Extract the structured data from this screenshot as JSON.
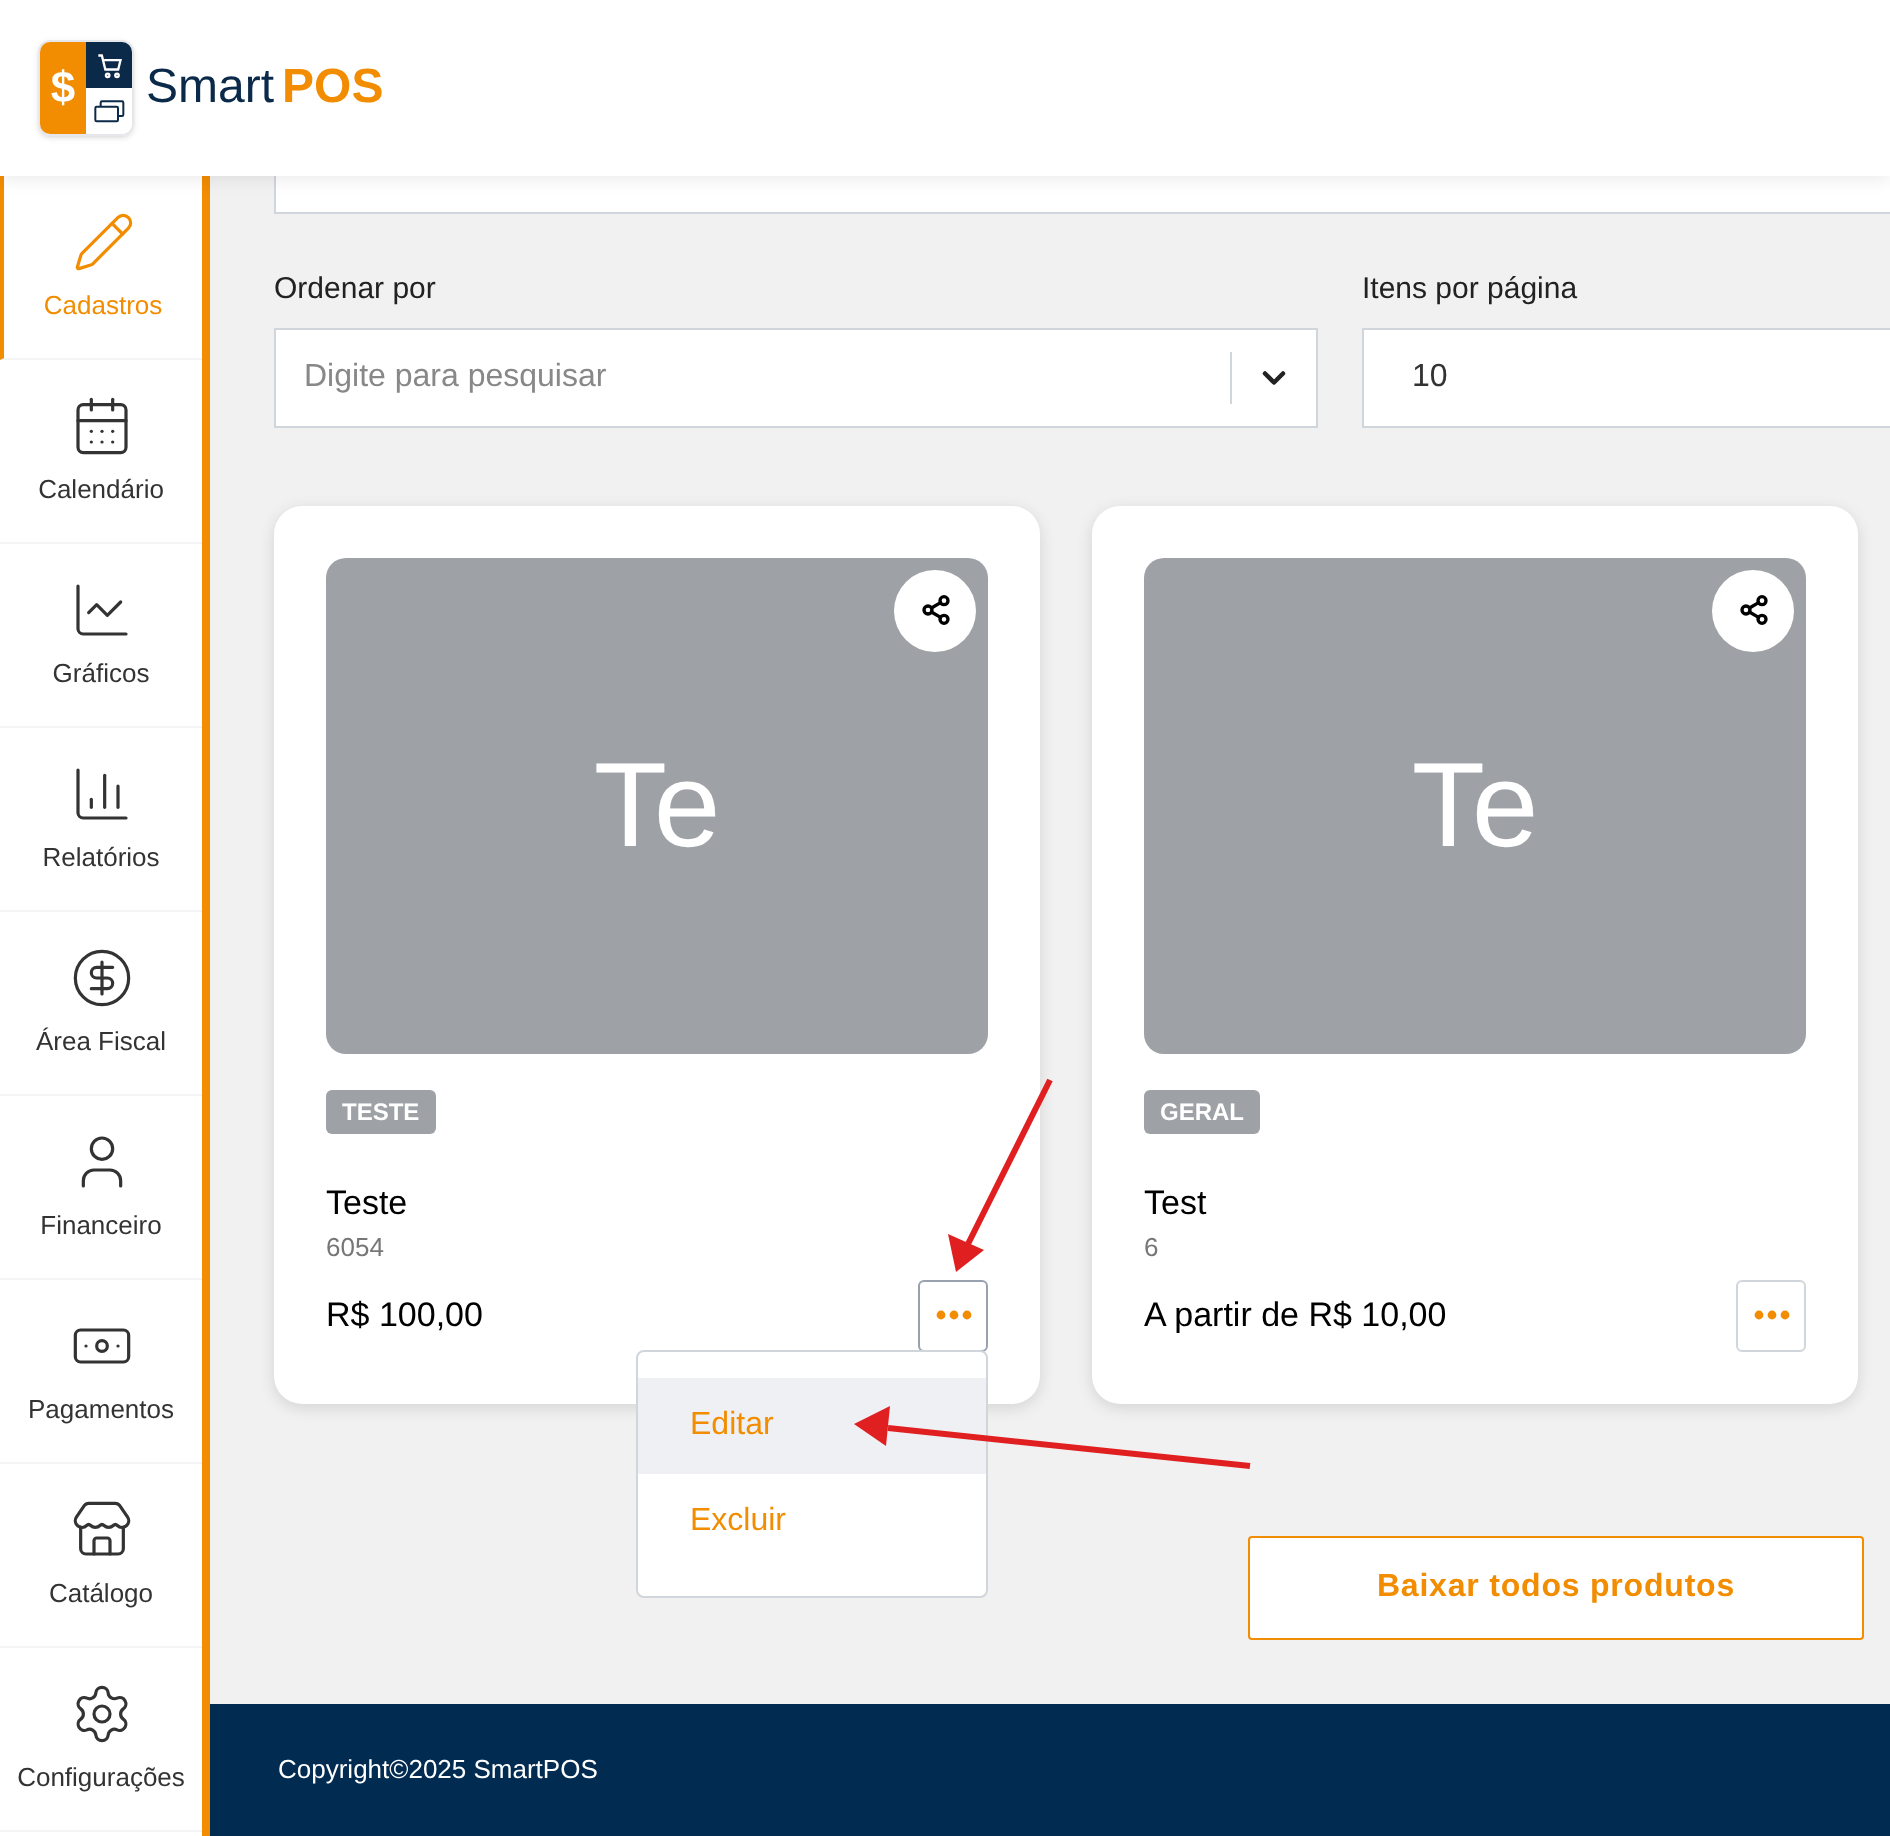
{
  "brand": {
    "mark": "$",
    "name": "Smart",
    "accent": "POS"
  },
  "sidebar": {
    "items": [
      {
        "label": "Cadastros",
        "selected": true
      },
      {
        "label": "Calendário",
        "selected": false
      },
      {
        "label": "Gráficos",
        "selected": false
      },
      {
        "label": "Relatórios",
        "selected": false
      },
      {
        "label": "Área Fiscal",
        "selected": false
      },
      {
        "label": "Financeiro",
        "selected": false
      },
      {
        "label": "Pagamentos",
        "selected": false
      },
      {
        "label": "Catálogo",
        "selected": false
      },
      {
        "label": "Configurações",
        "selected": false
      }
    ]
  },
  "sort": {
    "label": "Ordenar por",
    "placeholder": "Digite para pesquisar"
  },
  "per_page": {
    "label": "Itens por página",
    "value": "10"
  },
  "products": [
    {
      "initials": "Te",
      "tag": "TESTE",
      "name": "Teste",
      "code": "6054",
      "price": "R$ 100,00",
      "menu_open": true
    },
    {
      "initials": "Te",
      "tag": "GERAL",
      "name": "Test",
      "code": "6",
      "price": "A partir de R$ 10,00",
      "menu_open": false
    }
  ],
  "menu": [
    {
      "label": "Editar",
      "selected": true
    },
    {
      "label": "Excluir",
      "selected": false
    }
  ],
  "download_button": "Baixar todos produtos",
  "footer": "Copyright©2025 SmartPOS"
}
